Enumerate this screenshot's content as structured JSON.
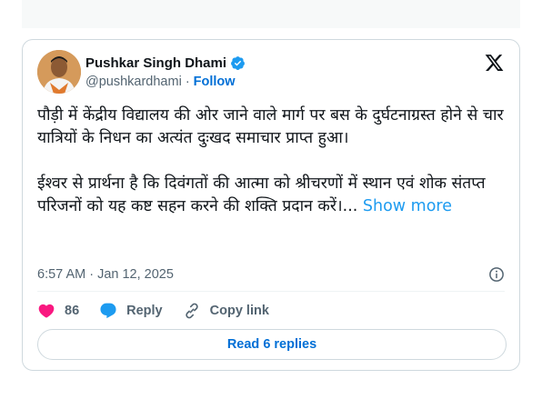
{
  "author": {
    "name": "Pushkar Singh Dhami",
    "handle": "@pushkardhami",
    "separator": "·",
    "follow_label": "Follow",
    "verified": true
  },
  "tweet": {
    "text": "पौड़ी में केंद्रीय विद्यालय की ओर जाने वाले मार्ग पर बस के दुर्घटनाग्रस्त होने से चार यात्रियों के निधन का अत्यंत दुःखद समाचार प्राप्त हुआ।\n\nईश्वर से प्रार्थना है कि दिवंगतों की आत्मा को श्रीचरणों में स्थान एवं शोक संतप्त परिजनों को यह कष्ट सहन करने की शक्ति प्रदान करें।... ",
    "show_more_label": "Show more",
    "timestamp": "6:57 AM · Jan 12, 2025"
  },
  "actions": {
    "like_count": "86",
    "reply_label": "Reply",
    "copy_link_label": "Copy link"
  },
  "footer": {
    "read_replies_label": "Read 6 replies"
  },
  "colors": {
    "accent": "#1d9bf0",
    "link_blue": "#006fd6",
    "heart": "#f91880",
    "muted": "#536471"
  },
  "icons": [
    "verified-badge-icon",
    "x-logo-icon",
    "info-icon",
    "heart-icon",
    "reply-bubble-icon",
    "link-icon"
  ]
}
